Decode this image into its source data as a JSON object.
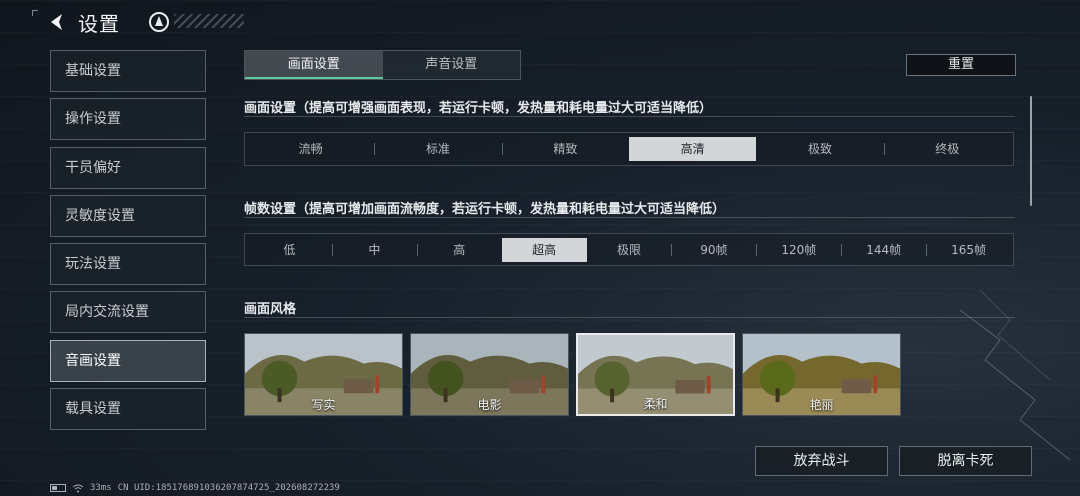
{
  "header": {
    "title": "设置"
  },
  "sidebar": {
    "items": [
      {
        "label": "基础设置"
      },
      {
        "label": "操作设置"
      },
      {
        "label": "干员偏好"
      },
      {
        "label": "灵敏度设置"
      },
      {
        "label": "玩法设置"
      },
      {
        "label": "局内交流设置"
      },
      {
        "label": "音画设置"
      },
      {
        "label": "载具设置"
      }
    ],
    "active_index": 6
  },
  "tabs": [
    {
      "label": "画面设置"
    },
    {
      "label": "声音设置"
    }
  ],
  "reset_label": "重置",
  "quality": {
    "title": "画面设置（提高可增强画面表现，若运行卡顿，发热量和耗电量过大可适当降低）",
    "options": [
      "流畅",
      "标准",
      "精致",
      "高清",
      "极致",
      "终极"
    ],
    "selected": "高清"
  },
  "fps": {
    "title": "帧数设置（提高可增加画面流畅度，若运行卡顿，发热量和耗电量过大可适当降低）",
    "options": [
      "低",
      "中",
      "高",
      "超高",
      "极限",
      "90帧",
      "120帧",
      "144帧",
      "165帧"
    ],
    "selected": "超高"
  },
  "style": {
    "title": "画面风格",
    "options": [
      "写实",
      "电影",
      "柔和",
      "艳丽"
    ],
    "selected": "柔和"
  },
  "buttons": {
    "abandon": "放弃战斗",
    "unstuck": "脱离卡死"
  },
  "status": {
    "ping": "33ms",
    "uid": "CN UID:185176891036207874725_202608272239"
  },
  "colors": {
    "accent": "#5fc79c",
    "selected_bg": "#d3d6d9"
  }
}
